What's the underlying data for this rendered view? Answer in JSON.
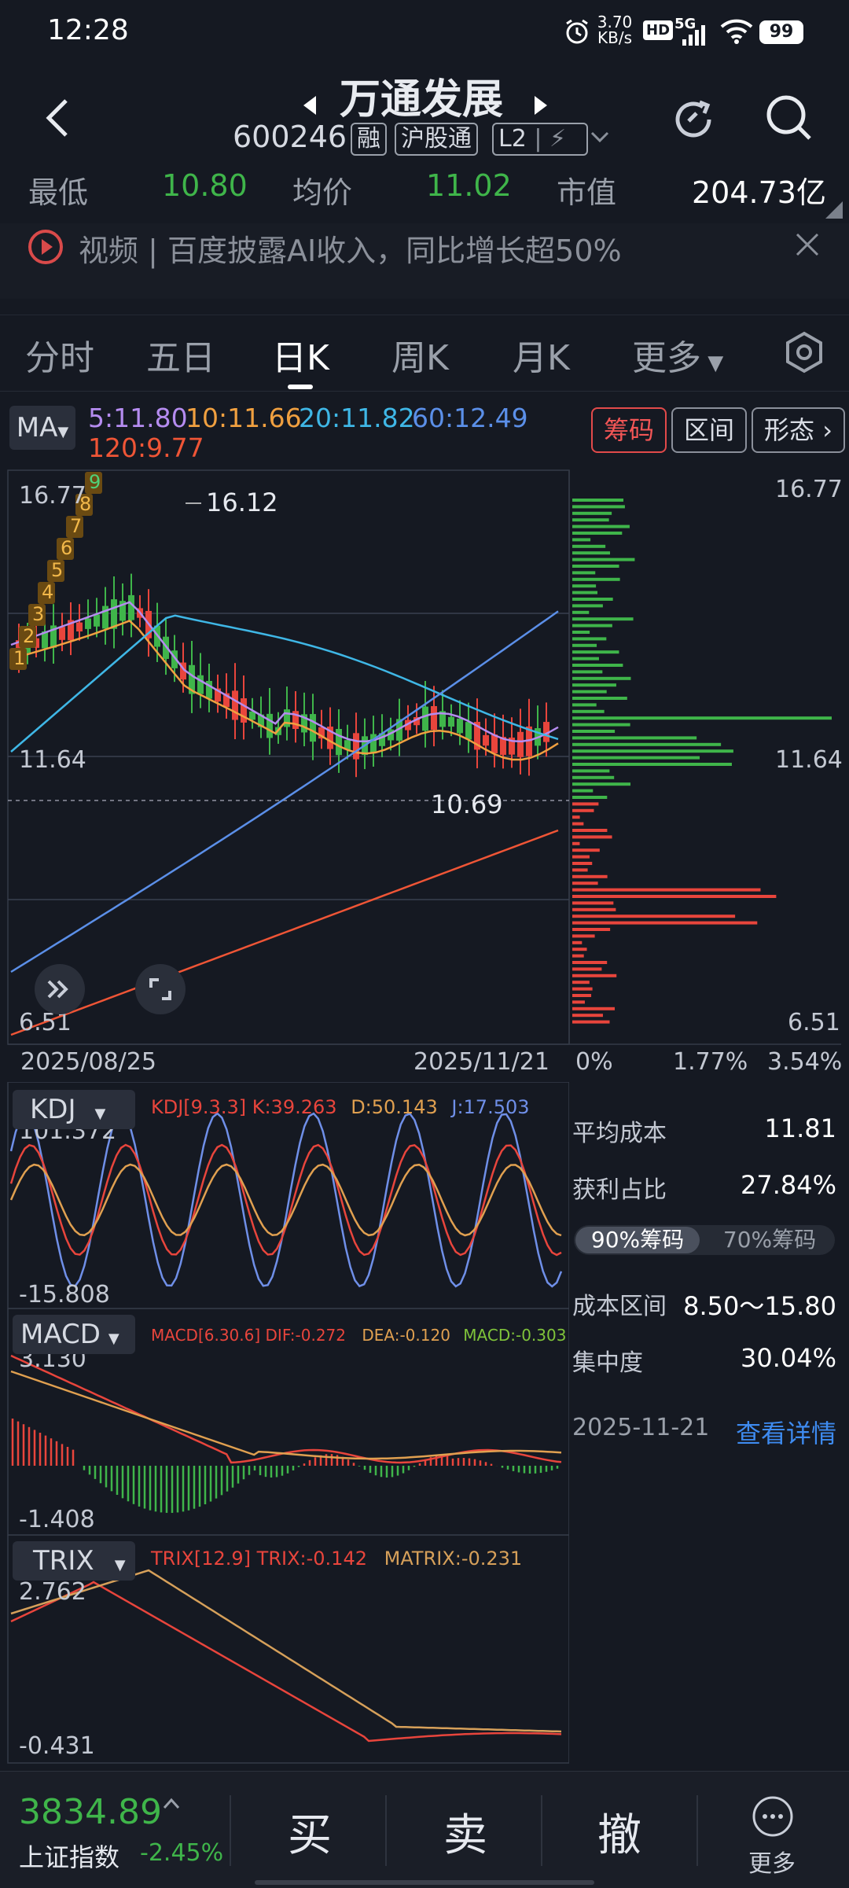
{
  "status_bar": {
    "time": "12:28",
    "speed": "3.70",
    "speed_unit": "KB/s",
    "hd": "HD",
    "net": "5G",
    "battery": "99"
  },
  "header": {
    "title": "万通发展",
    "code": "600246",
    "tags": [
      "融",
      "沪股通",
      "L2"
    ]
  },
  "quote": {
    "low_label": "最低",
    "low": "10.80",
    "avg_label": "均价",
    "avg": "11.02",
    "mktcap_label": "市值",
    "mktcap": "204.73亿"
  },
  "news": {
    "text": "视频 | 百度披露AI收入，同比增长超50%"
  },
  "tabs": [
    "分时",
    "五日",
    "日K",
    "周K",
    "月K",
    "更多"
  ],
  "active_tab": "日K",
  "ma": {
    "select": "MA",
    "ma5": "5:11.80",
    "ma10": "10:11.66",
    "ma20": "20:11.82",
    "ma60": "60:12.49",
    "ma120": "120:9.77",
    "btn_chips": "筹码",
    "btn_range": "区间",
    "btn_pattern": "形态"
  },
  "kchart": {
    "max_label": "16.77",
    "mid_label": "11.64",
    "min_label": "6.51",
    "high_annot": "16.12",
    "low_annot": "10.69",
    "date_start": "2025/08/25",
    "date_end": "2025/11/21",
    "signals": [
      "1",
      "2",
      "3",
      "4",
      "5",
      "6",
      "7",
      "8",
      "9"
    ]
  },
  "chips": {
    "top": "16.77",
    "mid": "11.64",
    "bottom": "6.51",
    "axis": [
      "0%",
      "1.77%",
      "3.54%"
    ]
  },
  "kdj": {
    "name": "KDJ",
    "params": "KDJ[9.3.3]",
    "k": "K:39.263",
    "d": "D:50.143",
    "j": "J:17.503",
    "max": "101.372",
    "min": "-15.808"
  },
  "macd": {
    "name": "MACD",
    "params": "MACD[6.30.6]",
    "dif": "DIF:-0.272",
    "dea": "DEA:-0.120",
    "macd": "MACD:-0.303",
    "max": "3.130",
    "min": "-1.408"
  },
  "trix": {
    "name": "TRIX",
    "params": "TRIX[12.9]",
    "trix": "TRIX:-0.142",
    "matrix": "MATRIX:-0.231",
    "max": "2.762",
    "min": "-0.431"
  },
  "chip_stats": {
    "avg_cost_label": "平均成本",
    "avg_cost": "11.81",
    "profit_label": "获利占比",
    "profit": "27.84%",
    "seg90": "90%筹码",
    "seg70": "70%筹码",
    "range_label": "成本区间",
    "range": "8.50～15.80",
    "conc_label": "集中度",
    "conc": "30.04%",
    "date": "2025-11-21",
    "detail": "查看详情"
  },
  "bottom": {
    "index_value": "3834.89",
    "index_name": "上证指数",
    "index_change": "-2.45%",
    "buy": "买",
    "sell": "卖",
    "cancel": "撤",
    "more": "更多"
  },
  "colors": {
    "up": "#e8453c",
    "down": "#3fb54a",
    "ma5": "#b58cf0",
    "ma10": "#f0a040",
    "ma20": "#3fb7e6",
    "ma60": "#5b8fe8",
    "ma120": "#ef5536",
    "accent_blue": "#3e8bf0"
  }
}
